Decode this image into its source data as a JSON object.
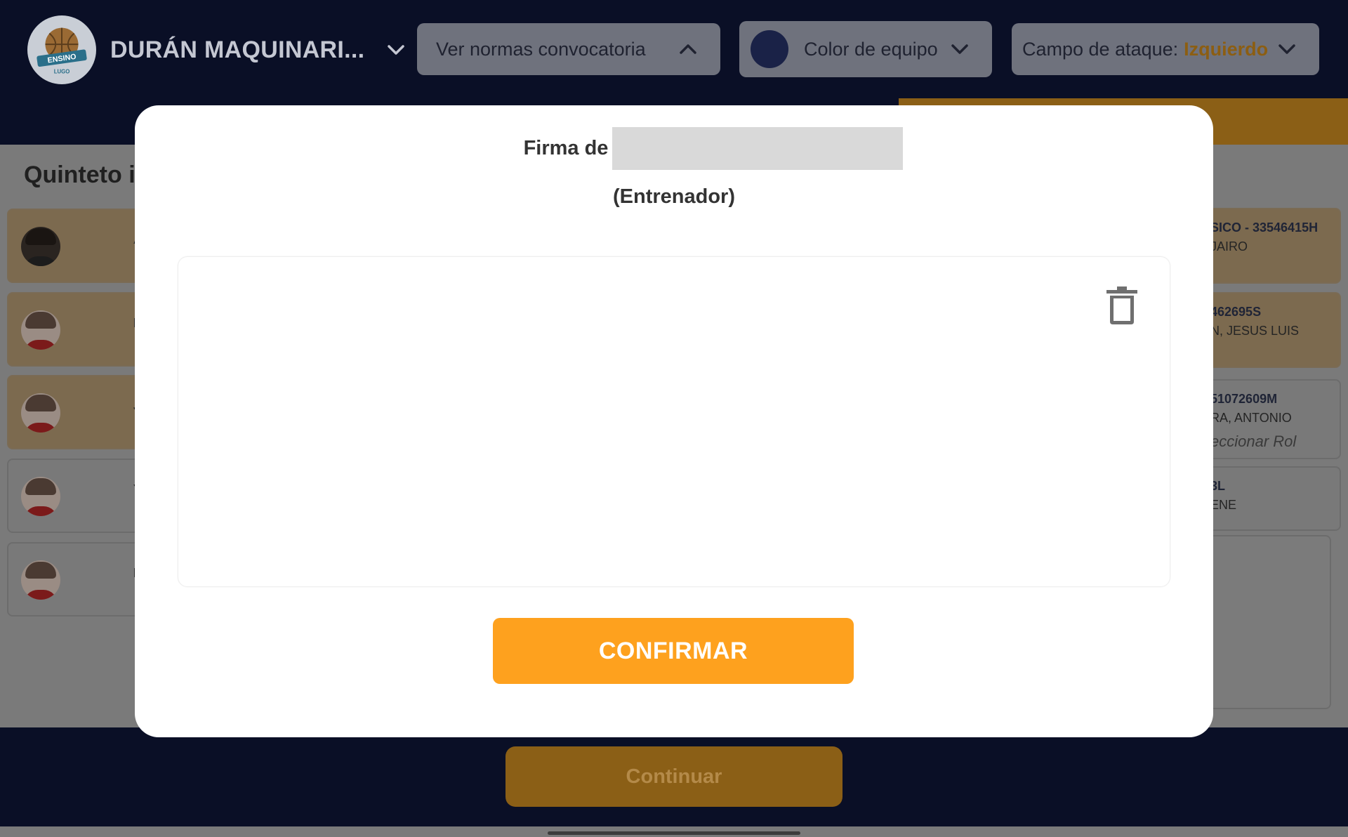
{
  "header": {
    "team_name": "DURÁN MAQUINARI...",
    "logo": {
      "top_text": "ENSINO",
      "bottom_text": "LUGO"
    },
    "rules_button": "Ver normas convocatoria",
    "team_color": {
      "label": "Color de equipo",
      "swatch": "#1a2247"
    },
    "attack_field": {
      "label": "Campo de ataque:",
      "value": "Izquierdo"
    }
  },
  "main": {
    "section_title": "Quinteto i",
    "left_players": [
      {
        "initial": "A",
        "active": true
      },
      {
        "initial": "F",
        "active": true
      },
      {
        "initial": "J",
        "active": true
      },
      {
        "initial": "Y",
        "active": false
      },
      {
        "initial": "I",
        "active": false
      }
    ],
    "staff": [
      {
        "id": "SICO - 33546415H",
        "name": "JAIRO",
        "active": true
      },
      {
        "id": "462695S",
        "name": "N, JESUS LUIS",
        "active": true
      },
      {
        "id": "51072609M",
        "name": "RA, ANTONIO",
        "role": "eccionar Rol",
        "active": false
      },
      {
        "id": "3L",
        "name": "ENE",
        "active": false
      }
    ]
  },
  "modal": {
    "signature_prefix": "Firma de",
    "role": "(Entrenador)",
    "confirm_label": "CONFIRMAR"
  },
  "footer": {
    "continue_label": "Continuar"
  },
  "colors": {
    "navy": "#0a0f26",
    "accent_orange": "#fea11e",
    "dim_orange": "#8b5f16"
  }
}
